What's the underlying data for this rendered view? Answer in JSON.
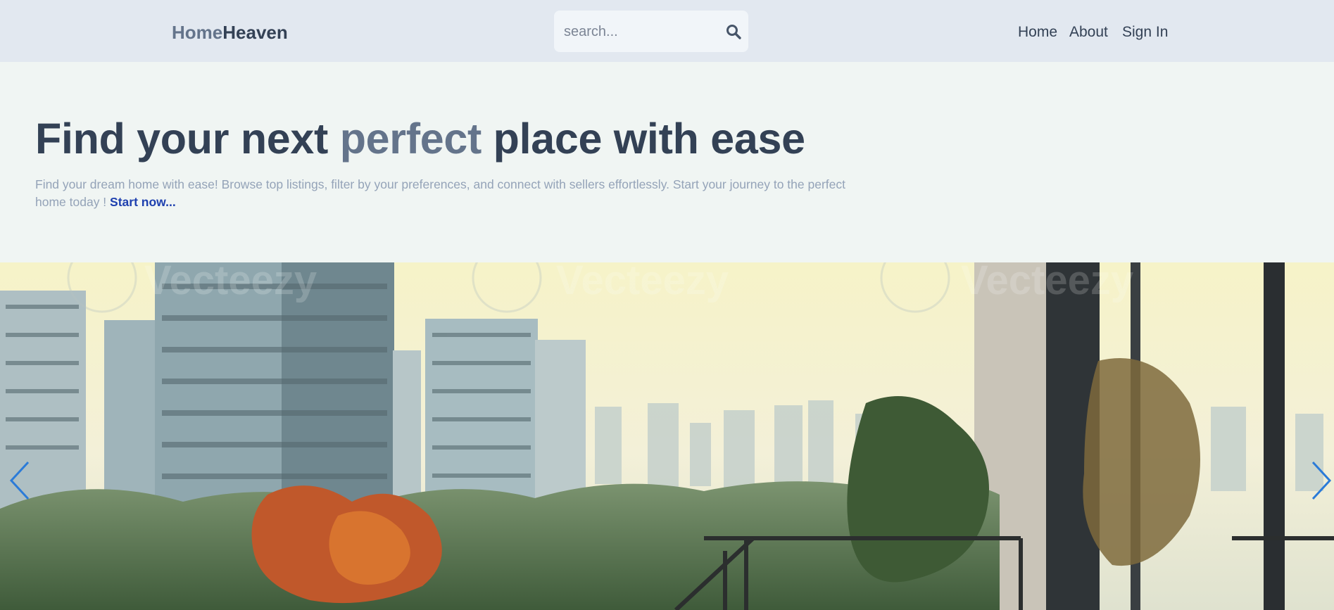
{
  "header": {
    "logo": {
      "part1": "Home",
      "part2": "Heaven"
    },
    "search": {
      "placeholder": "search...",
      "value": "",
      "icon": "search-icon"
    },
    "nav": [
      {
        "label": "Home"
      },
      {
        "label": "About"
      },
      {
        "label": "Sign In"
      }
    ]
  },
  "hero": {
    "title_start": "Find your next ",
    "title_accent": "perfect",
    "title_end": " place with ease",
    "description": "Find your dream home with ease! Browse top listings, filter by your preferences, and connect with sellers effortlessly. Start your journey to the perfect home today ! ",
    "cta_label": "Start now..."
  },
  "carousel": {
    "image_alt": "",
    "watermark": "Vecteezy",
    "prev_icon": "chevron-left-icon",
    "next_icon": "chevron-right-icon"
  },
  "colors": {
    "header_bg": "#e2e8f0",
    "hero_bg": "#f0f5f3",
    "title": "#334155",
    "accent": "#64748b",
    "link": "#1e40af",
    "carousel_arrow": "#2b7bd8"
  }
}
